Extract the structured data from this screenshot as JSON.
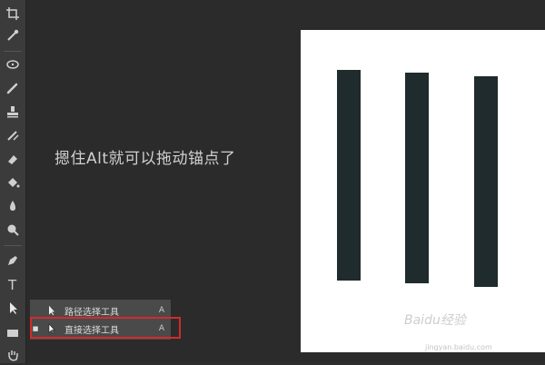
{
  "caption": "摁住Alt就可以拖动锚点了",
  "flyout": {
    "items": [
      {
        "label": "路径选择工具",
        "shortcut": "A",
        "selected": false
      },
      {
        "label": "直接选择工具",
        "shortcut": "A",
        "selected": true
      }
    ]
  },
  "watermark": {
    "brand": "Baidu经验",
    "url": "jingyan.baidu.com"
  },
  "colors": {
    "toolbar_bg": "#3b3b3b",
    "workspace_bg": "#2b2b2b",
    "document_bg": "#ffffff",
    "bar_fill": "#1f2b2c",
    "highlight_border": "#d12b2b"
  },
  "tools": [
    "crop-icon",
    "eyedropper-icon",
    "spot-healing-icon",
    "brush-icon",
    "clone-stamp-icon",
    "history-brush-icon",
    "eraser-icon",
    "paint-bucket-icon",
    "blur-icon",
    "dodge-icon",
    "pen-icon",
    "type-icon",
    "path-selection-icon",
    "rectangle-shape-icon",
    "hand-icon"
  ]
}
